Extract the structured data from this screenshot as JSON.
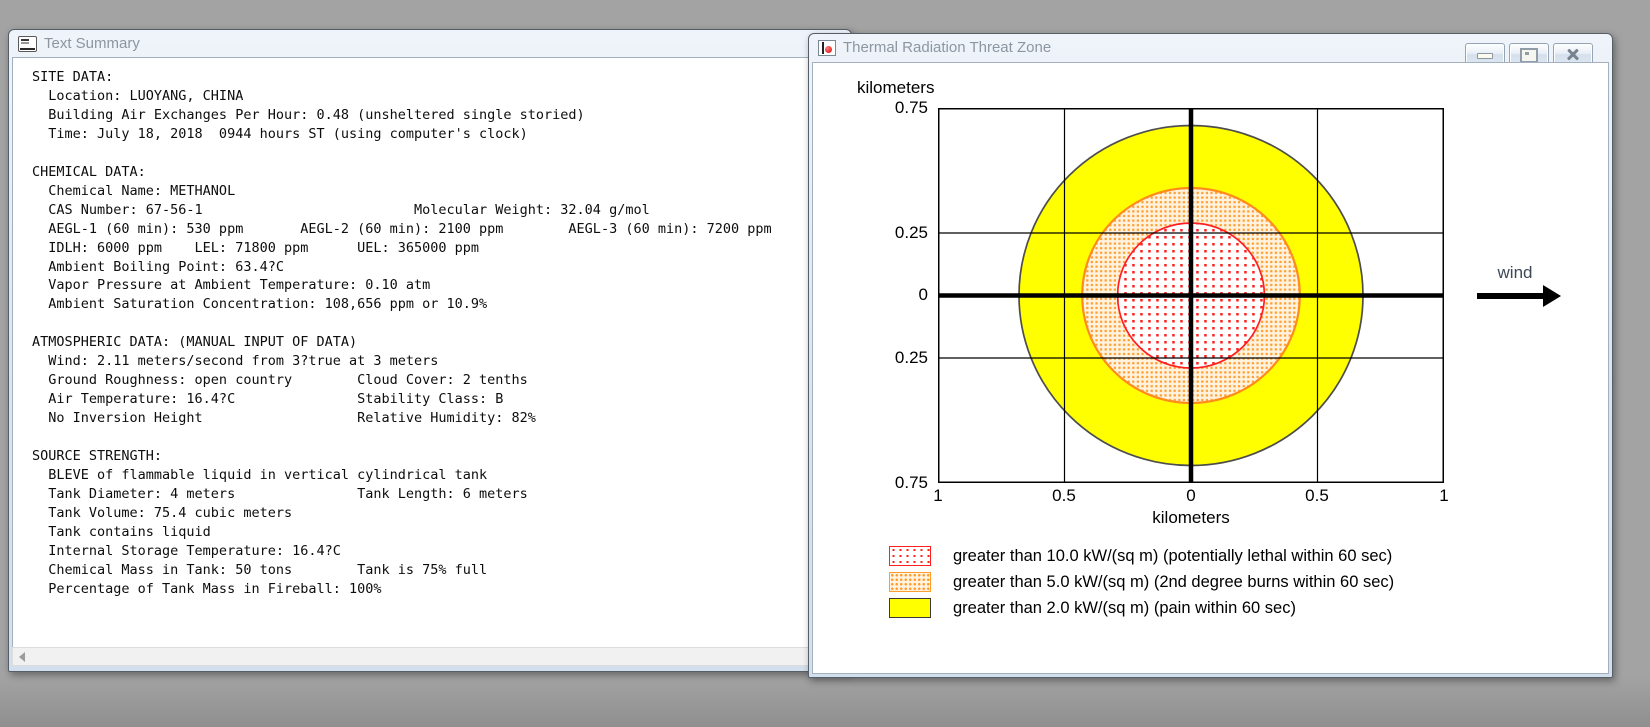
{
  "desktop": {
    "background": "#a3a3a3"
  },
  "colors": {
    "zone_yellow": "#ffff00",
    "zone_yellow_line": "#4d4d4d",
    "zone_orange_dot": "#ff9d2e",
    "zone_orange_line": "#ff8c1a",
    "zone_red_dot": "#ff2020",
    "zone_red_line": "#ff2020",
    "titlebar_text": "#8d96a0",
    "wind_text": "#3e4856"
  },
  "left_window": {
    "title": "Text Summary",
    "icon": "text-document-icon",
    "content_lines": [
      "SITE DATA:",
      "  Location: LUOYANG, CHINA",
      "  Building Air Exchanges Per Hour: 0.48 (unsheltered single storied)",
      "  Time: July 18, 2018  0944 hours ST (using computer's clock)",
      "",
      "CHEMICAL DATA:",
      "  Chemical Name: METHANOL",
      "  CAS Number: 67-56-1                          Molecular Weight: 32.04 g/mol",
      "  AEGL-1 (60 min): 530 ppm       AEGL-2 (60 min): 2100 ppm        AEGL-3 (60 min): 7200 ppm",
      "  IDLH: 6000 ppm    LEL: 71800 ppm      UEL: 365000 ppm",
      "  Ambient Boiling Point: 63.4?C",
      "  Vapor Pressure at Ambient Temperature: 0.10 atm",
      "  Ambient Saturation Concentration: 108,656 ppm or 10.9%",
      "",
      "ATMOSPHERIC DATA: (MANUAL INPUT OF DATA)",
      "  Wind: 2.11 meters/second from 3?true at 3 meters",
      "  Ground Roughness: open country        Cloud Cover: 2 tenths",
      "  Air Temperature: 16.4?C               Stability Class: B",
      "  No Inversion Height                   Relative Humidity: 82%",
      "",
      "SOURCE STRENGTH:",
      "  BLEVE of flammable liquid in vertical cylindrical tank",
      "  Tank Diameter: 4 meters               Tank Length: 6 meters",
      "  Tank Volume: 75.4 cubic meters",
      "  Tank contains liquid",
      "  Internal Storage Temperature: 16.4?C",
      "  Chemical Mass in Tank: 50 tons        Tank is 75% full",
      "  Percentage of Tank Mass in Fireball: 100%"
    ]
  },
  "right_window": {
    "title": "Thermal Radiation Threat Zone",
    "icon": "threat-zone-icon",
    "window_buttons": [
      "minimize",
      "maximize",
      "close"
    ],
    "plot": {
      "y_axis_unit": "kilometers",
      "x_axis_unit": "kilometers",
      "y_tick_labels": [
        "0.75",
        "0.25",
        "0",
        "0.25",
        "0.75"
      ],
      "x_tick_labels": [
        "1",
        "0.5",
        "0",
        "0.5",
        "1"
      ],
      "wind_label": "wind"
    },
    "legend": [
      {
        "style": "red-dots",
        "label": "greater than 10.0 kW/(sq m) (potentially lethal within 60 sec)"
      },
      {
        "style": "orange-dots",
        "label": "greater than 5.0 kW/(sq m) (2nd degree burns within 60 sec)"
      },
      {
        "style": "yellow-solid",
        "label": "greater than 2.0 kW/(sq m) (pain within 60 sec)"
      }
    ]
  },
  "chart_data": {
    "type": "area",
    "title": "Thermal Radiation Threat Zone",
    "xlabel": "kilometers",
    "ylabel": "kilometers",
    "xlim": [
      -1,
      1
    ],
    "ylim": [
      -0.75,
      0.75
    ],
    "x_ticks": [
      -1,
      -0.5,
      0,
      0.5,
      1
    ],
    "y_ticks": [
      -0.75,
      -0.25,
      0,
      0.25,
      0.75
    ],
    "grid": true,
    "legend_position": "below",
    "center": [
      0,
      0
    ],
    "wind_direction": "left-to-right",
    "zones": [
      {
        "style": "red-dots",
        "threshold_kw_sqm": 10.0,
        "effect": "potentially lethal within 60 sec",
        "radius_km": 0.29
      },
      {
        "style": "orange-dots",
        "threshold_kw_sqm": 5.0,
        "effect": "2nd degree burns within 60 sec",
        "radius_km": 0.43
      },
      {
        "style": "yellow-solid",
        "threshold_kw_sqm": 2.0,
        "effect": "pain within 60 sec",
        "radius_km": 0.68
      }
    ]
  }
}
